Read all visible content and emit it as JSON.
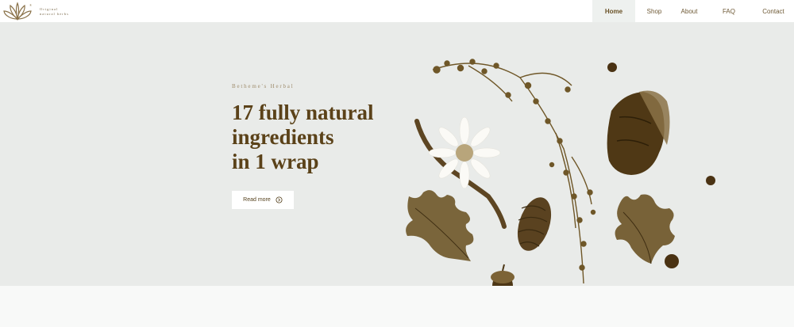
{
  "brand": {
    "line1": "Original",
    "line2": "natural herbs",
    "logo_icon": "fan-leaf-logo"
  },
  "nav": {
    "items": [
      {
        "label": "Home",
        "active": true
      },
      {
        "label": "Shop",
        "active": false
      },
      {
        "label": "About",
        "active": false
      },
      {
        "label": "FAQ",
        "active": false
      },
      {
        "label": "Contact",
        "active": false
      }
    ]
  },
  "hero": {
    "eyebrow": "Betheme's Herbal",
    "headline": [
      "17 fully natural",
      "ingredients",
      "in 1 wrap"
    ],
    "cta_label": "Read more",
    "cta_icon": "circled-arrow-icon"
  },
  "colors": {
    "header_bg": "#ffffff",
    "hero_bg": "#e9ebe9",
    "text_brown": "#5b4219",
    "accent_brown": "#6f5a36"
  }
}
